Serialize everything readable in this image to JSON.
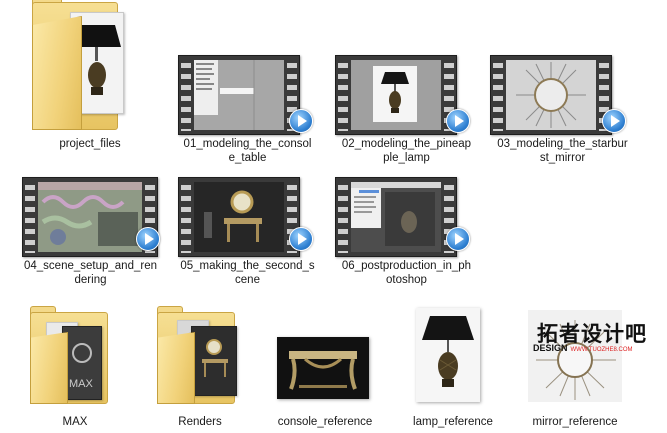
{
  "items": [
    {
      "type": "folder",
      "label": "project_files"
    },
    {
      "type": "video",
      "label": "01_modeling_the_console_table"
    },
    {
      "type": "video",
      "label": "02_modeling_the_pineapple_lamp"
    },
    {
      "type": "video",
      "label": "03_modeling_the_starburst_mirror"
    },
    {
      "type": "video",
      "label": "04_scene_setup_and_rendering"
    },
    {
      "type": "video",
      "label": "05_making_the_second_scene"
    },
    {
      "type": "video",
      "label": "06_postproduction_in_photoshop"
    },
    {
      "type": "folder",
      "label": "MAX"
    },
    {
      "type": "folder",
      "label": "Renders"
    },
    {
      "type": "image",
      "label": "console_reference"
    },
    {
      "type": "image",
      "label": "lamp_reference"
    },
    {
      "type": "image",
      "label": "mirror_reference"
    }
  ],
  "captions": {
    "project_files": "project_files",
    "v01": "01_modeling_the_consol\ne_table",
    "v02": "02_modeling_the_pineap\nple_lamp",
    "v03": "03_modeling_the_starbur\nst_mirror",
    "v04": "04_scene_setup_and_ren\ndering",
    "v05": "05_making_the_second_s\ncene",
    "v06": "06_postproduction_in_ph\notoshop",
    "max": "MAX",
    "renders": "Renders",
    "console": "console_reference",
    "lamp": "lamp_reference",
    "mirror": "mirror_reference"
  },
  "watermark": {
    "big": "拓者设计吧",
    "design": "DESIGN",
    "url": "WWW.TUOZHE8.COM"
  },
  "colors": {
    "folder": "#f1d27a",
    "play": "#2e7fd1",
    "film": "#3a3a3a"
  }
}
